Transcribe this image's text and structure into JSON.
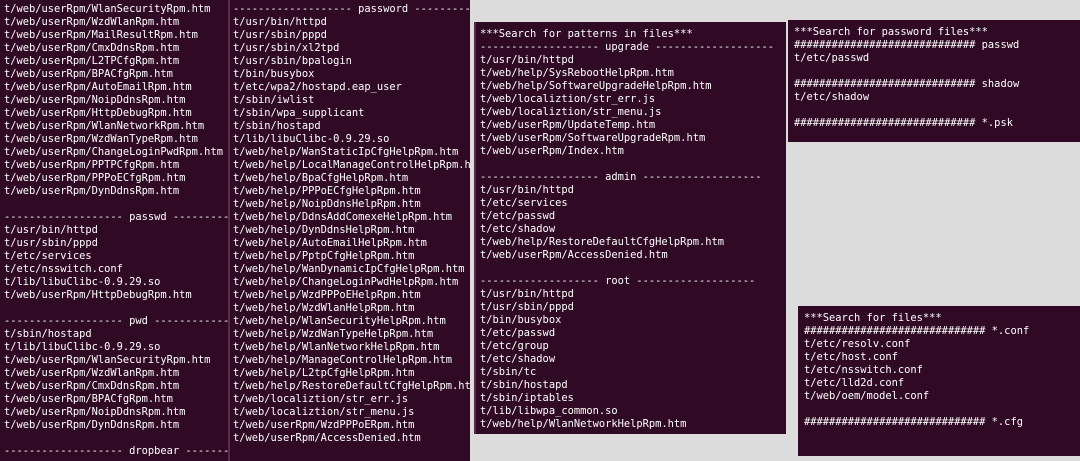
{
  "col1": [
    "t/web/userRpm/WlanSecurityRpm.htm",
    "t/web/userRpm/WzdWlanRpm.htm",
    "t/web/userRpm/MailResultRpm.htm",
    "t/web/userRpm/CmxDdnsRpm.htm",
    "t/web/userRpm/L2TPCfgRpm.htm",
    "t/web/userRpm/BPACfgRpm.htm",
    "t/web/userRpm/AutoEmailRpm.htm",
    "t/web/userRpm/NoipDdnsRpm.htm",
    "t/web/userRpm/HttpDebugRpm.htm",
    "t/web/userRpm/WlanNetworkRpm.htm",
    "t/web/userRpm/WzdWanTypeRpm.htm",
    "t/web/userRpm/ChangeLoginPwdRpm.htm",
    "t/web/userRpm/PPTPCfgRpm.htm",
    "t/web/userRpm/PPPoECfgRpm.htm",
    "t/web/userRpm/DynDdnsRpm.htm",
    "",
    "------------------- passwd -----------",
    "t/usr/bin/httpd",
    "t/usr/sbin/pppd",
    "t/etc/services",
    "t/etc/nsswitch.conf",
    "t/lib/libuClibc-0.9.29.so",
    "t/web/userRpm/HttpDebugRpm.htm",
    "",
    "------------------- pwd -------------",
    "t/sbin/hostapd",
    "t/lib/libuClibc-0.9.29.so",
    "t/web/userRpm/WlanSecurityRpm.htm",
    "t/web/userRpm/WzdWlanRpm.htm",
    "t/web/userRpm/CmxDdnsRpm.htm",
    "t/web/userRpm/BPACfgRpm.htm",
    "t/web/userRpm/NoipDdnsRpm.htm",
    "t/web/userRpm/DynDdnsRpm.htm",
    "",
    "------------------- dropbear ------------------"
  ],
  "col2": [
    "------------------- password -------------------",
    "t/usr/bin/httpd",
    "t/usr/sbin/pppd",
    "t/usr/sbin/xl2tpd",
    "t/usr/sbin/bpalogin",
    "t/bin/busybox",
    "t/etc/wpa2/hostapd.eap_user",
    "t/sbin/iwlist",
    "t/sbin/wpa_supplicant",
    "t/sbin/hostapd",
    "t/lib/libuClibc-0.9.29.so",
    "t/web/help/WanStaticIpCfgHelpRpm.htm",
    "t/web/help/LocalManageControlHelpRpm.htm",
    "t/web/help/BpaCfgHelpRpm.htm",
    "t/web/help/PPPoECfgHelpRpm.htm",
    "t/web/help/NoipDdnsHelpRpm.htm",
    "t/web/help/DdnsAddComexeHelpRpm.htm",
    "t/web/help/DynDdnsHelpRpm.htm",
    "t/web/help/AutoEmailHelpRpm.htm",
    "t/web/help/PptpCfgHelpRpm.htm",
    "t/web/help/WanDynamicIpCfgHelpRpm.htm",
    "t/web/help/ChangeLoginPwdHelpRpm.htm",
    "t/web/help/WzdPPPoEHelpRpm.htm",
    "t/web/help/WzdWlanHelpRpm.htm",
    "t/web/help/WlanSecurityHelpRpm.htm",
    "t/web/help/WzdWanTypeHelpRpm.htm",
    "t/web/help/WlanNetworkHelpRpm.htm",
    "t/web/help/ManageControlHelpRpm.htm",
    "t/web/help/L2tpCfgHelpRpm.htm",
    "t/web/help/RestoreDefaultCfgHelpRpm.htm",
    "t/web/localiztion/str_err.js",
    "t/web/localiztion/str_menu.js",
    "t/web/userRpm/WzdPPPoERpm.htm",
    "t/web/userRpm/AccessDenied.htm"
  ],
  "col3": [
    "***Search for patterns in files***",
    "------------------- upgrade -------------------",
    "t/usr/bin/httpd",
    "t/web/help/SysRebootHelpRpm.htm",
    "t/web/help/SoftwareUpgradeHelpRpm.htm",
    "t/web/localiztion/str_err.js",
    "t/web/localiztion/str_menu.js",
    "t/web/userRpm/UpdateTemp.htm",
    "t/web/userRpm/SoftwareUpgradeRpm.htm",
    "t/web/userRpm/Index.htm",
    "",
    "------------------- admin -------------------",
    "t/usr/bin/httpd",
    "t/etc/services",
    "t/etc/passwd",
    "t/etc/shadow",
    "t/web/help/RestoreDefaultCfgHelpRpm.htm",
    "t/web/userRpm/AccessDenied.htm",
    "",
    "------------------- root -------------------",
    "t/usr/bin/httpd",
    "t/usr/sbin/pppd",
    "t/bin/busybox",
    "t/etc/passwd",
    "t/etc/group",
    "t/etc/shadow",
    "t/sbin/tc",
    "t/sbin/hostapd",
    "t/sbin/iptables",
    "t/lib/libwpa_common.so",
    "t/web/help/WlanNetworkHelpRpm.htm"
  ],
  "col4": [
    "***Search for password files***",
    "############################# passwd",
    "t/etc/passwd",
    "",
    "############################# shadow",
    "t/etc/shadow",
    "",
    "############################# *.psk"
  ],
  "col5": [
    "***Search for files***",
    "############################# *.conf",
    "t/etc/resolv.conf",
    "t/etc/host.conf",
    "t/etc/nsswitch.conf",
    "t/etc/lld2d.conf",
    "t/web/oem/model.conf",
    "",
    "############################# *.cfg"
  ]
}
